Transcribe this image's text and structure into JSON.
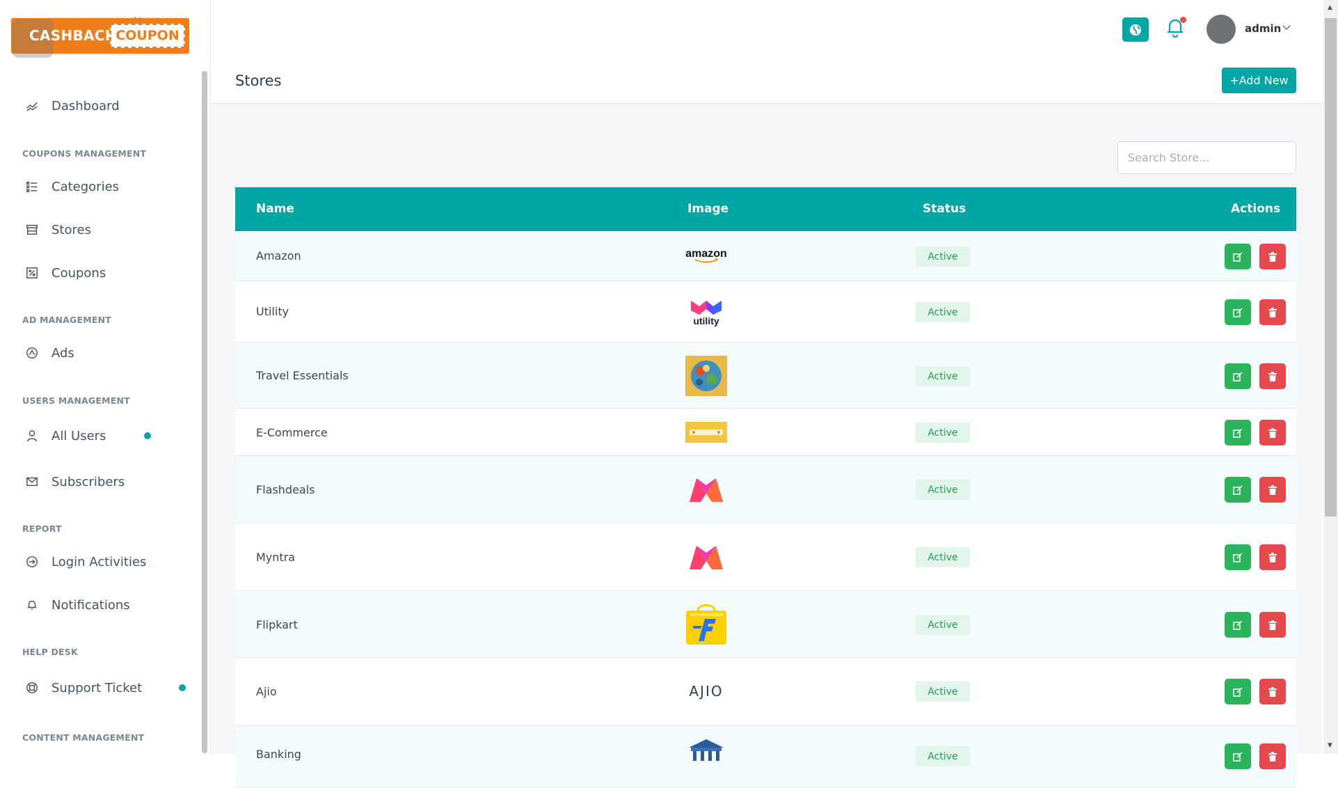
{
  "logo": {
    "left": "CASHBACK",
    "right": "COUPON"
  },
  "sidebar": {
    "dashboard": "Dashboard",
    "sections": [
      {
        "heading": "COUPONS MANAGEMENT",
        "items": [
          "Categories",
          "Stores",
          "Coupons"
        ]
      },
      {
        "heading": "AD MANAGEMENT",
        "items": [
          "Ads"
        ]
      },
      {
        "heading": "USERS MANAGEMENT",
        "items": [
          "All Users",
          "Subscribers"
        ]
      },
      {
        "heading": "REPORT",
        "items": [
          "Login Activities",
          "Notifications"
        ]
      },
      {
        "heading": "HELP DESK",
        "items": [
          "Support Ticket"
        ]
      },
      {
        "heading": "CONTENT MANAGEMENT",
        "items": []
      }
    ]
  },
  "header": {
    "username": "admin"
  },
  "page": {
    "title": "Stores",
    "add_button": "+Add New",
    "search_placeholder": "Search Store..."
  },
  "table": {
    "columns": [
      "Name",
      "Image",
      "Status",
      "Actions"
    ],
    "rows": [
      {
        "name": "Amazon",
        "logo": "amazon",
        "status": "Active"
      },
      {
        "name": "Utility",
        "logo": "utility",
        "status": "Active"
      },
      {
        "name": "Travel Essentials",
        "logo": "travel-essentials",
        "status": "Active"
      },
      {
        "name": "E-Commerce",
        "logo": "e-commerce",
        "status": "Active"
      },
      {
        "name": "Flashdeals",
        "logo": "myntra-m",
        "status": "Active"
      },
      {
        "name": "Myntra",
        "logo": "myntra-m",
        "status": "Active"
      },
      {
        "name": "Flipkart",
        "logo": "flipkart",
        "status": "Active"
      },
      {
        "name": "Ajio",
        "logo": "ajio",
        "status": "Active"
      },
      {
        "name": "Banking",
        "logo": "bank",
        "status": "Active"
      }
    ]
  },
  "colors": {
    "accent": "#00a6a3",
    "edit": "#2bb45b",
    "delete": "#e5484d",
    "logo_orange": "#ef7d1a"
  }
}
